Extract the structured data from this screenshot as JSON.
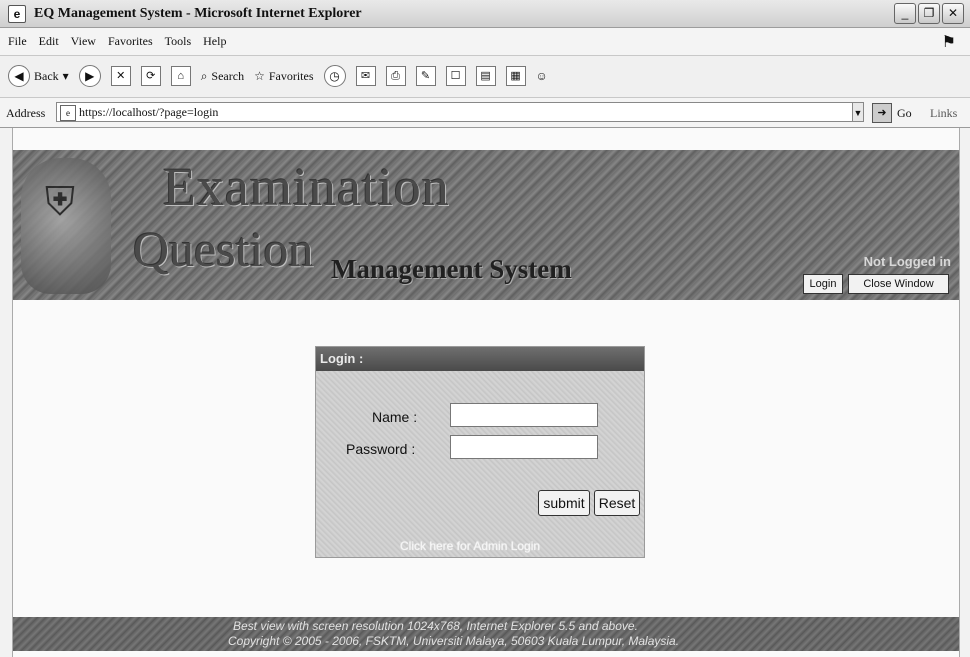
{
  "window": {
    "title": "EQ Management System - Microsoft Internet Explorer",
    "icon": "ie-page-icon"
  },
  "menu": [
    "File",
    "Edit",
    "View",
    "Favorites",
    "Tools",
    "Help"
  ],
  "toolbar": {
    "back_label": "Back",
    "search_label": "Search",
    "favorites_label": "Favorites"
  },
  "address": {
    "label": "Address",
    "url": "https://localhost/?page=login",
    "go_label": "Go",
    "links_label": "Links"
  },
  "banner": {
    "line1": "Examination",
    "line2": "Question",
    "line3": "Management System",
    "status": "Not Logged in",
    "login_button": "Login",
    "close_button": "Close Window"
  },
  "login": {
    "header": "Login :",
    "name_label": "Name :",
    "name_value": "",
    "password_label": "Password :",
    "password_value": "",
    "submit_label": "submit",
    "reset_label": "Reset",
    "admin_link": "Click here for Admin Login"
  },
  "footer": {
    "line1": "Best view with screen resolution 1024x768, Internet Explorer 5.5 and above.",
    "line2": "Copyright © 2005 - 2006, FSKTM, Universiti Malaya, 50603 Kuala Lumpur, Malaysia."
  }
}
